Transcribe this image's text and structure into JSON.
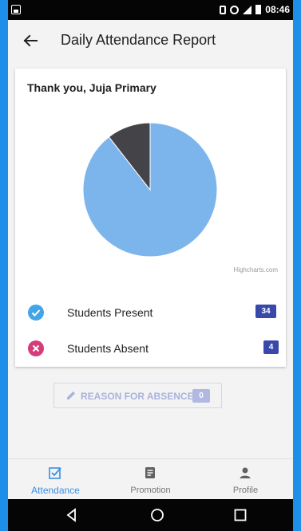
{
  "status_bar": {
    "time": "08:46"
  },
  "app_bar": {
    "title": "Daily Attendance Report",
    "back_icon": "arrow-back-icon"
  },
  "card": {
    "greeting": "Thank you, Juja Primary",
    "credits": "Highcharts.com",
    "stats": [
      {
        "label": "Students Present",
        "count": "34",
        "icon": "check-circle-icon",
        "color": "#43a5e8"
      },
      {
        "label": "Students Absent",
        "count": "4",
        "icon": "cancel-circle-icon",
        "color": "#d63c7a"
      }
    ]
  },
  "chart_data": {
    "type": "pie",
    "categories": [
      "Students Present",
      "Students Absent"
    ],
    "values": [
      34,
      4
    ],
    "colors": [
      "#7cb5ec",
      "#434348"
    ],
    "title": ""
  },
  "reason_button": {
    "label": "REASON FOR ABSENCE",
    "count": "0",
    "icon": "pencil-icon"
  },
  "bottom_nav": [
    {
      "label": "Attendance",
      "icon": "checkbox-icon",
      "active": true
    },
    {
      "label": "Promotion",
      "icon": "document-icon",
      "active": false
    },
    {
      "label": "Profile",
      "icon": "person-icon",
      "active": false
    }
  ],
  "colors": {
    "accent": "#3a8ee6",
    "badge": "#3949ab",
    "frame": "#1e8fe8"
  }
}
